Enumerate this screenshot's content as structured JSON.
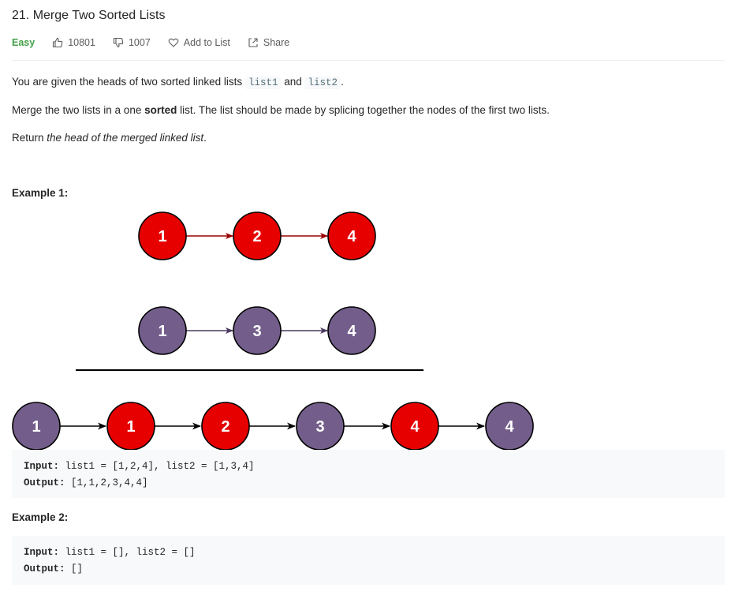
{
  "problem": {
    "title": "21. Merge Two Sorted Lists",
    "difficulty": "Easy",
    "likes": "10801",
    "dislikes": "1007",
    "add_to_list": "Add to List",
    "share": "Share"
  },
  "description": {
    "p1_before": "You are given the heads of two sorted linked lists ",
    "p1_code1": "list1",
    "p1_mid": " and ",
    "p1_code2": "list2",
    "p1_after": ".",
    "p2_before": "Merge the two lists in a one ",
    "p2_bold": "sorted",
    "p2_after": " list. The list should be made by splicing together the nodes of the first two lists.",
    "p3_before": "Return ",
    "p3_italic": "the head of the merged linked list",
    "p3_after": "."
  },
  "example1": {
    "title": "Example 1:",
    "list1_nodes": [
      "1",
      "2",
      "4"
    ],
    "list2_nodes": [
      "1",
      "3",
      "4"
    ],
    "merged_nodes": [
      "1",
      "1",
      "2",
      "3",
      "4",
      "4"
    ],
    "input_label": "Input:",
    "input_value": " list1 = [1,2,4], list2 = [1,3,4]",
    "output_label": "Output:",
    "output_value": " [1,1,2,3,4,4]"
  },
  "example2": {
    "title": "Example 2:",
    "input_label": "Input:",
    "input_value": " list1 = [], list2 = []",
    "output_label": "Output:",
    "output_value": " []"
  },
  "colors": {
    "red_node": "#e60000",
    "purple_node": "#735e8b",
    "easy": "#43a047",
    "code_bg": "#f7f9fa"
  }
}
